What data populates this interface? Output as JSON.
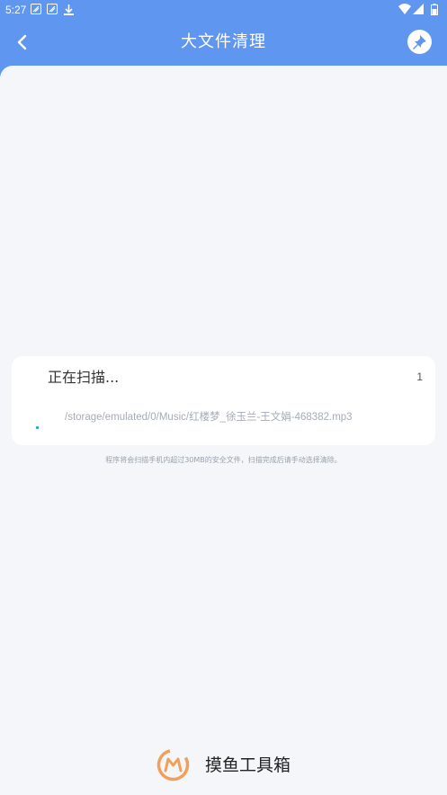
{
  "status_bar": {
    "time": "5:27"
  },
  "header": {
    "title": "大文件清理",
    "background_color": "#5f97f0"
  },
  "scan": {
    "status_label": "正在扫描...",
    "count": "1",
    "current_path": "/storage/emulated/0/Music/红楼梦_徐玉兰-王文娟-468382.mp3"
  },
  "hint": "程序将会扫描手机内超过30MB的安全文件，扫描完成后请手动选择清除。",
  "brand": {
    "name": "摸鱼工具箱",
    "accent_color": "#f0a05a"
  },
  "icons": {
    "back": "chevron-left-icon",
    "pin": "pin-icon",
    "wifi": "wifi-icon",
    "signal": "signal-icon",
    "battery": "battery-icon"
  }
}
